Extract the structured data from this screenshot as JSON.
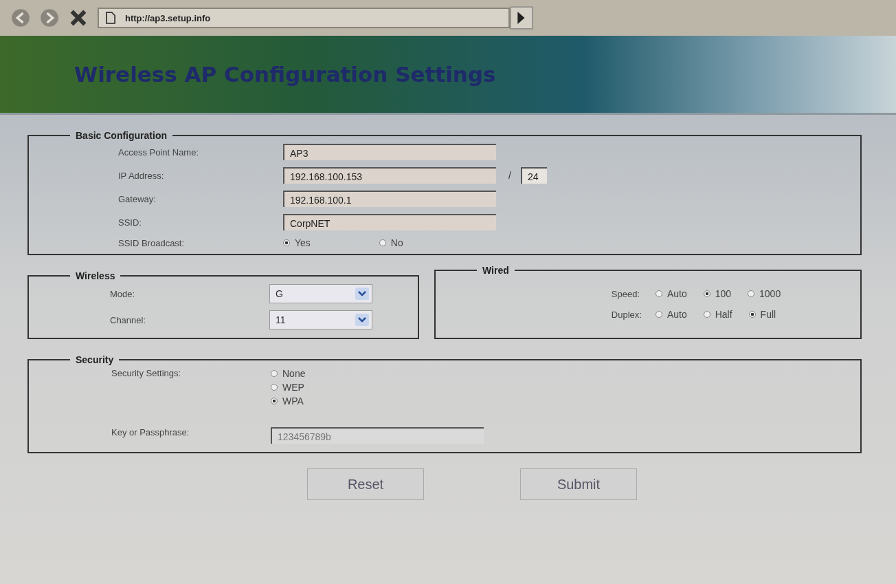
{
  "browser": {
    "url": "http://ap3.setup.info"
  },
  "header": {
    "title": "Wireless AP Configuration Settings"
  },
  "basic": {
    "legend": "Basic Configuration",
    "fields": [
      {
        "label": "Access Point Name:",
        "value": "AP3"
      },
      {
        "label": "IP Address:",
        "value": "192.168.100.153",
        "separator": "/",
        "suffix": "24"
      },
      {
        "label": "Gateway:",
        "value": "192.168.100.1"
      },
      {
        "label": "SSID:",
        "value": "CorpNET"
      }
    ],
    "broadcast": {
      "label": "SSID Broadcast:",
      "options": [
        {
          "label": "Yes",
          "selected": true
        },
        {
          "label": "No",
          "selected": false
        }
      ]
    }
  },
  "wireless": {
    "legend": "Wireless",
    "selects": [
      {
        "label": "Mode:",
        "value": "G"
      },
      {
        "label": "Channel:",
        "value": "11"
      }
    ]
  },
  "wired": {
    "legend": "Wired",
    "groups": [
      {
        "label": "Speed:",
        "options": [
          {
            "label": "Auto",
            "selected": false
          },
          {
            "label": "100",
            "selected": true
          },
          {
            "label": "1000",
            "selected": false
          }
        ]
      },
      {
        "label": "Duplex:",
        "options": [
          {
            "label": "Auto",
            "selected": false
          },
          {
            "label": "Half",
            "selected": false
          },
          {
            "label": "Full",
            "selected": true
          }
        ]
      }
    ]
  },
  "security": {
    "legend": "Security",
    "settings_label": "Security Settings:",
    "options": [
      {
        "label": "None",
        "selected": false
      },
      {
        "label": "WEP",
        "selected": false
      },
      {
        "label": "WPA",
        "selected": true
      }
    ],
    "key_label": "Key or Passphrase:",
    "key_value": "123456789b"
  },
  "buttons": [
    "Reset",
    "Submit"
  ]
}
